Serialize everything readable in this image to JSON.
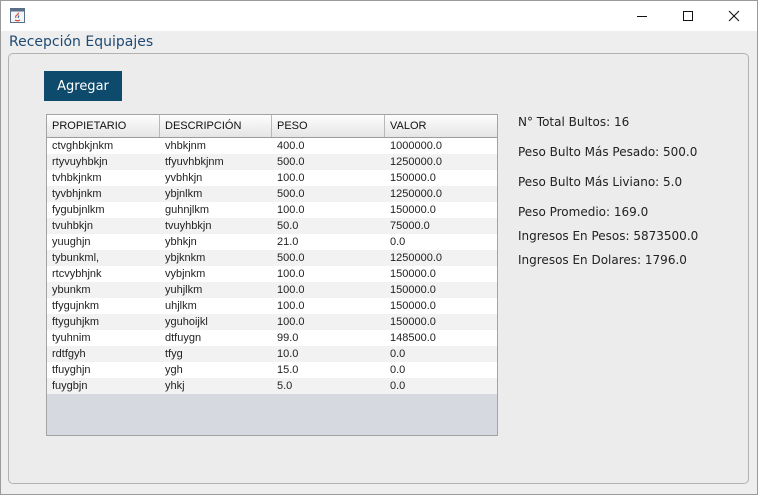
{
  "window": {
    "title": "",
    "controls": {
      "minimize": "minimize-icon",
      "maximize": "maximize-icon",
      "close": "close-icon"
    }
  },
  "header": {
    "title": "Recepción Equipajes"
  },
  "toolbar": {
    "add_label": "Agregar"
  },
  "colors": {
    "accent": "#0e4a6b",
    "header_text": "#1e4a73"
  },
  "table": {
    "columns": [
      "PROPIETARIO",
      "DESCRIPCIÓN",
      "PESO",
      "VALOR"
    ],
    "rows": [
      [
        "ctvghbkjnkm",
        "vhbkjnm",
        "400.0",
        "1000000.0"
      ],
      [
        "rtyvuyhbkjn",
        "tfyuvhbkjnm",
        "500.0",
        "1250000.0"
      ],
      [
        "tvhbkjnkm",
        "yvbhkjn",
        "100.0",
        "150000.0"
      ],
      [
        "tyvbhjnkm",
        "ybjnlkm",
        "500.0",
        "1250000.0"
      ],
      [
        "fygubjnlkm",
        "guhnjlkm",
        "100.0",
        "150000.0"
      ],
      [
        "tvuhbkjn",
        "tvuyhbkjn",
        "50.0",
        "75000.0"
      ],
      [
        "yuughjn",
        "ybhkjn",
        "21.0",
        "0.0"
      ],
      [
        "tybunkml,",
        "ybjknkm",
        "500.0",
        "1250000.0"
      ],
      [
        "rtcvybhjnk",
        "vybjnkm",
        "100.0",
        "150000.0"
      ],
      [
        "ybunkm",
        "yuhjlkm",
        "100.0",
        "150000.0"
      ],
      [
        "tfygujnkm",
        "uhjlkm",
        "100.0",
        "150000.0"
      ],
      [
        "ftyguhjkm",
        "yguhoijkl",
        "100.0",
        "150000.0"
      ],
      [
        "tyuhnim",
        "dtfuygn",
        "99.0",
        "148500.0"
      ],
      [
        "rdtfgyh",
        "tfyg",
        "10.0",
        "0.0"
      ],
      [
        "tfuyghjn",
        "ygh",
        "15.0",
        "0.0"
      ],
      [
        "fuygbjn",
        "yhkj",
        "5.0",
        "0.0"
      ]
    ]
  },
  "stats": {
    "total_bultos": "N° Total Bultos: 16",
    "peso_max": "Peso Bulto Más Pesado: 500.0",
    "peso_min": "Peso Bulto Más Liviano: 5.0",
    "peso_promedio": "Peso Promedio: 169.0",
    "ingresos_pesos": "Ingresos En Pesos: 5873500.0",
    "ingresos_dolares": "Ingresos En Dolares: 1796.0"
  }
}
